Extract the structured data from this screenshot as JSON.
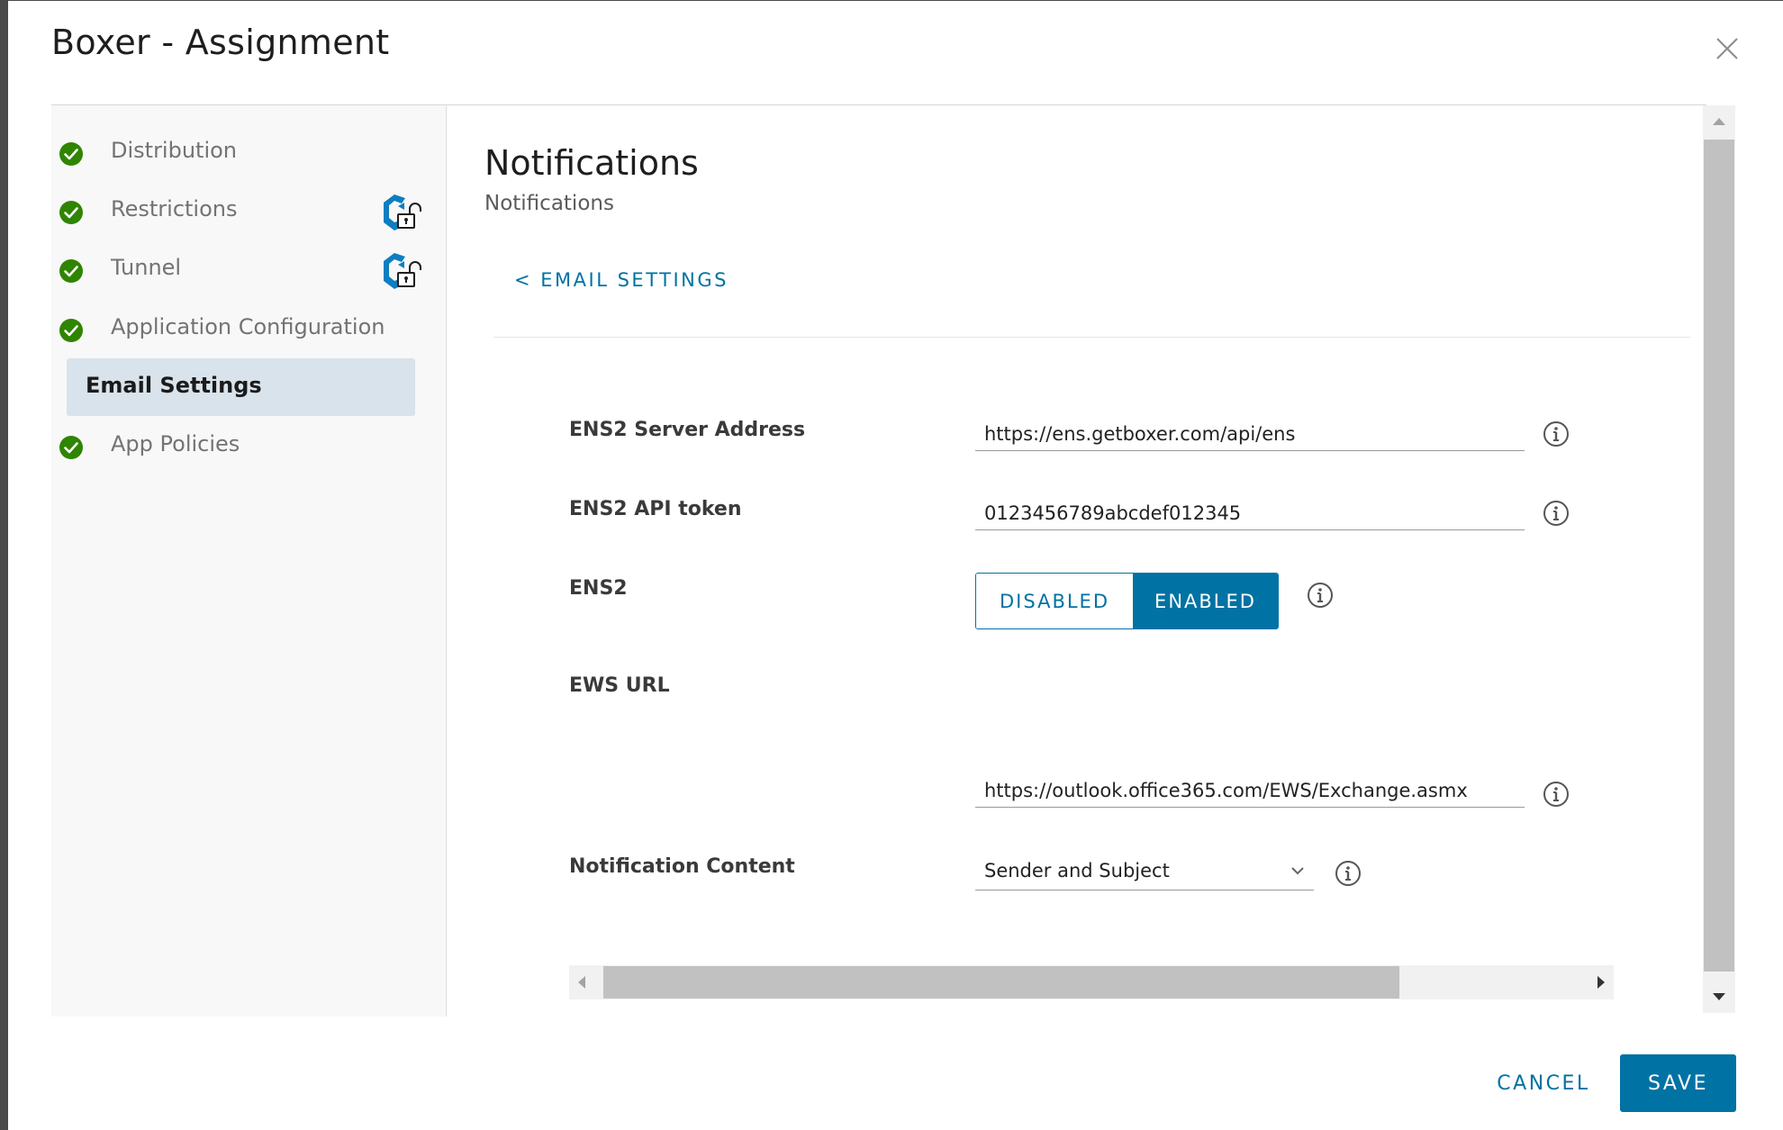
{
  "dialog": {
    "title": "Boxer - Assignment"
  },
  "nav": {
    "items": [
      {
        "label": "Distribution",
        "status": "complete"
      },
      {
        "label": "Restrictions",
        "status": "complete",
        "badge": "lock-unlocked-icon"
      },
      {
        "label": "Tunnel",
        "status": "complete",
        "badge": "lock-unlocked-icon"
      },
      {
        "label": "Application Configuration",
        "status": "complete"
      },
      {
        "label": "Email Settings",
        "status": "active"
      },
      {
        "label": "App Policies",
        "status": "complete"
      }
    ]
  },
  "section": {
    "title": "Notifications",
    "subtitle": "Notifications",
    "back_link": "< EMAIL SETTINGS"
  },
  "form": {
    "ens2_server_address": {
      "label": "ENS2 Server Address",
      "value": "https://ens.getboxer.com/api/ens"
    },
    "ens2_api_token": {
      "label": "ENS2 API token",
      "value": "0123456789abcdef012345"
    },
    "ens2": {
      "label": "ENS2",
      "off_label": "DISABLED",
      "on_label": "ENABLED",
      "selected": "ENABLED"
    },
    "ews_url": {
      "label": "EWS URL",
      "value": "https://outlook.office365.com/EWS/Exchange.asmx"
    },
    "notification_content": {
      "label": "Notification Content",
      "value": "Sender and Subject"
    }
  },
  "footer": {
    "cancel_label": "CANCEL",
    "save_label": "SAVE"
  },
  "colors": {
    "accent": "#0072a3",
    "success": "#2f8400",
    "active_nav_bg": "#d8e3eb",
    "nav_bg": "#f8f8f8"
  }
}
